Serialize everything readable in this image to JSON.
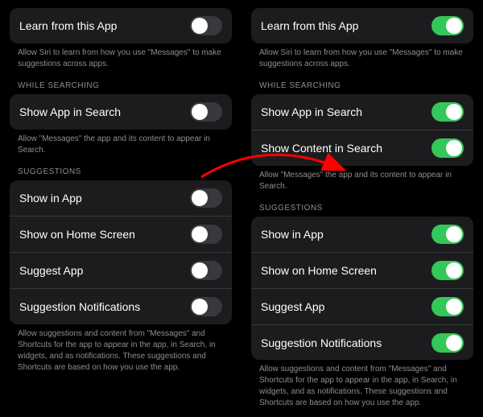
{
  "left": {
    "learn": {
      "label": "Learn from this App",
      "footer": "Allow Siri to learn from how you use \"Messages\" to make suggestions across apps."
    },
    "searching": {
      "header": "WHILE SEARCHING",
      "items": [
        {
          "label": "Show App in Search"
        }
      ],
      "footer": "Allow \"Messages\" the app and its content to appear in Search."
    },
    "suggestions": {
      "header": "SUGGESTIONS",
      "items": [
        {
          "label": "Show in App"
        },
        {
          "label": "Show on Home Screen"
        },
        {
          "label": "Suggest App"
        },
        {
          "label": "Suggestion Notifications"
        }
      ],
      "footer": "Allow suggestions and content from \"Messages\" and Shortcuts for the app to appear in the app, in Search, in widgets, and as notifications. These suggestions and Shortcuts are based on how you use the app."
    }
  },
  "right": {
    "learn": {
      "label": "Learn from this App",
      "footer": "Allow Siri to learn from how you use \"Messages\" to make suggestions across apps."
    },
    "searching": {
      "header": "WHILE SEARCHING",
      "items": [
        {
          "label": "Show App in Search"
        },
        {
          "label": "Show Content in Search"
        }
      ],
      "footer": "Allow \"Messages\" the app and its content to appear in Search."
    },
    "suggestions": {
      "header": "SUGGESTIONS",
      "items": [
        {
          "label": "Show in App"
        },
        {
          "label": "Show on Home Screen"
        },
        {
          "label": "Suggest App"
        },
        {
          "label": "Suggestion Notifications"
        }
      ],
      "footer": "Allow suggestions and content from \"Messages\" and Shortcuts for the app to appear in the app, in Search, in widgets, and as notifications. These suggestions and Shortcuts are based on how you use the app."
    }
  }
}
